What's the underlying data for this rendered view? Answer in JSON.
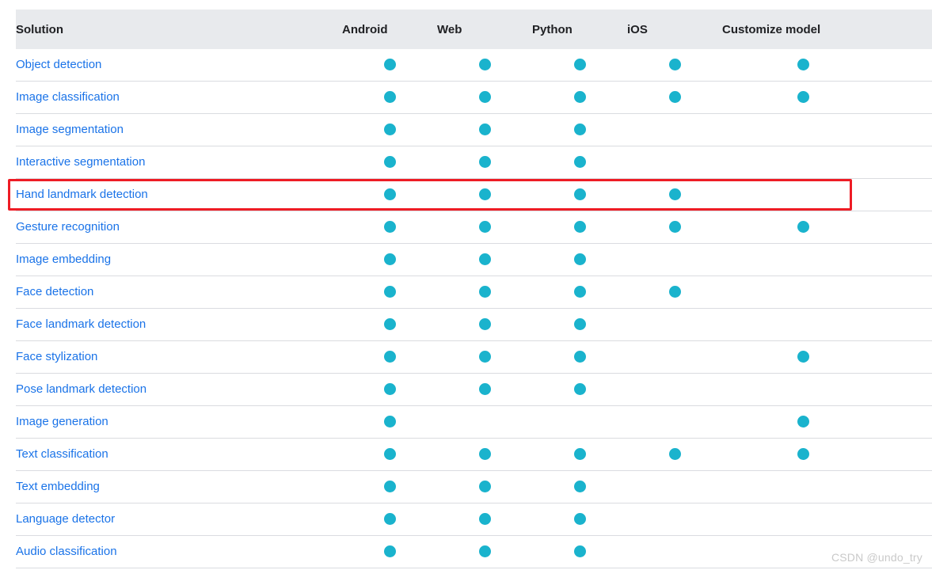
{
  "table": {
    "columns": [
      "Solution",
      "Android",
      "Web",
      "Python",
      "iOS",
      "Customize model"
    ],
    "rows": [
      {
        "solution": "Object detection",
        "android": true,
        "web": true,
        "python": true,
        "ios": true,
        "customize": true
      },
      {
        "solution": "Image classification",
        "android": true,
        "web": true,
        "python": true,
        "ios": true,
        "customize": true
      },
      {
        "solution": "Image segmentation",
        "android": true,
        "web": true,
        "python": true,
        "ios": false,
        "customize": false
      },
      {
        "solution": "Interactive segmentation",
        "android": true,
        "web": true,
        "python": true,
        "ios": false,
        "customize": false
      },
      {
        "solution": "Hand landmark detection",
        "android": true,
        "web": true,
        "python": true,
        "ios": true,
        "customize": false
      },
      {
        "solution": "Gesture recognition",
        "android": true,
        "web": true,
        "python": true,
        "ios": true,
        "customize": true
      },
      {
        "solution": "Image embedding",
        "android": true,
        "web": true,
        "python": true,
        "ios": false,
        "customize": false
      },
      {
        "solution": "Face detection",
        "android": true,
        "web": true,
        "python": true,
        "ios": true,
        "customize": false
      },
      {
        "solution": "Face landmark detection",
        "android": true,
        "web": true,
        "python": true,
        "ios": false,
        "customize": false
      },
      {
        "solution": "Face stylization",
        "android": true,
        "web": true,
        "python": true,
        "ios": false,
        "customize": true
      },
      {
        "solution": "Pose landmark detection",
        "android": true,
        "web": true,
        "python": true,
        "ios": false,
        "customize": false
      },
      {
        "solution": "Image generation",
        "android": true,
        "web": false,
        "python": false,
        "ios": false,
        "customize": true
      },
      {
        "solution": "Text classification",
        "android": true,
        "web": true,
        "python": true,
        "ios": true,
        "customize": true
      },
      {
        "solution": "Text embedding",
        "android": true,
        "web": true,
        "python": true,
        "ios": false,
        "customize": false
      },
      {
        "solution": "Language detector",
        "android": true,
        "web": true,
        "python": true,
        "ios": false,
        "customize": false
      },
      {
        "solution": "Audio classification",
        "android": true,
        "web": true,
        "python": true,
        "ios": false,
        "customize": false
      }
    ]
  },
  "annotation": {
    "highlighted_row": "Hand landmark detection",
    "box_color": "#ee1c25"
  },
  "watermark": {
    "text": "CSDN @undo_try"
  },
  "colors": {
    "link": "#1a73e8",
    "dot": "#1ab3cd",
    "header_bg": "#e8eaed",
    "row_border": "#dadce0"
  }
}
